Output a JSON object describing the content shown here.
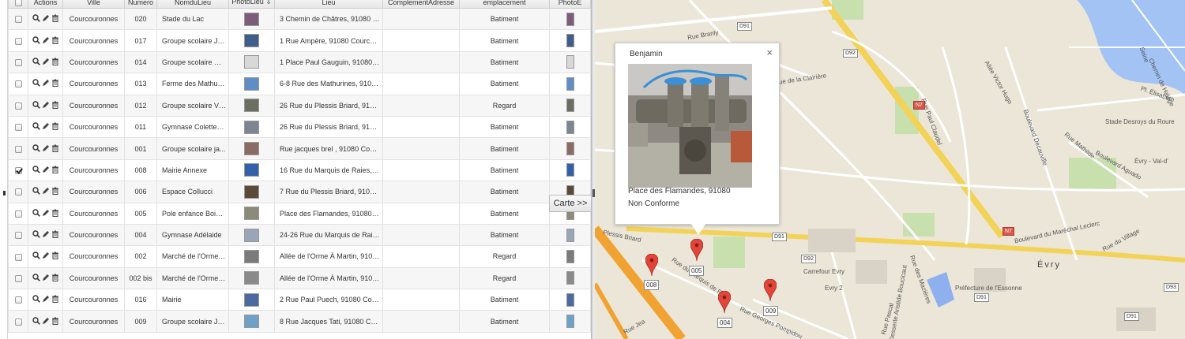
{
  "grid": {
    "columns": [
      "",
      "Actions",
      "Ville",
      "Numero",
      "NomduLieu",
      "PhotoLieu ⇩",
      "Lieu",
      "ComplementAdresse",
      "emplacement",
      "PhotoE"
    ],
    "rows": [
      {
        "checked": false,
        "ville": "Courcouronnes",
        "numero": "020",
        "nom": "Stade du Lac",
        "lieu": "3 Chemin de Châtres, 91080 C...",
        "complement": "",
        "emplacement": "Batiment",
        "thumb": "#7c5c7a"
      },
      {
        "checked": false,
        "ville": "Courcouronnes",
        "numero": "017",
        "nom": "Groupe scolaire Ju...",
        "lieu": "1 Rue Ampère, 91080 Courcou...",
        "complement": "",
        "emplacement": "Batiment",
        "thumb": "#3f5e8a"
      },
      {
        "checked": false,
        "ville": "Courcouronnes",
        "numero": "014",
        "nom": "Groupe scolaire Pa...",
        "lieu": "1 Place Paul Gauguin, 91080 C...",
        "complement": "",
        "emplacement": "Batiment",
        "thumb": "#d8d8d8"
      },
      {
        "checked": false,
        "ville": "Courcouronnes",
        "numero": "013",
        "nom": "Ferme des Mathuri...",
        "lieu": "6-8 Rue des Mathurines, 91080...",
        "complement": "",
        "emplacement": "Batiment",
        "thumb": "#5f8ec7"
      },
      {
        "checked": false,
        "ville": "Courcouronnes",
        "numero": "012",
        "nom": "Groupe scolaire Vi...",
        "lieu": "26 Rue du Plessis Briard, 9108...",
        "complement": "",
        "emplacement": "Regard",
        "thumb": "#6b6f61"
      },
      {
        "checked": false,
        "ville": "Courcouronnes",
        "numero": "011",
        "nom": "Gymnase Colette B...",
        "lieu": "26 Rue du Plessis Briard, 9108...",
        "complement": "",
        "emplacement": "Batiment",
        "thumb": "#7d8591"
      },
      {
        "checked": false,
        "ville": "Courcouronnes",
        "numero": "001",
        "nom": "Groupe scolaire ja...",
        "lieu": "Rue jacques brel , 91080 Cour...",
        "complement": "",
        "emplacement": "Batiment",
        "thumb": "#8a6c64"
      },
      {
        "checked": true,
        "ville": "Courcouronnes",
        "numero": "008",
        "nom": "Mairie Annexe",
        "lieu": "16 Rue du Marquis de Raies, 9...",
        "complement": "",
        "emplacement": "Batiment",
        "thumb": "#3360a8"
      },
      {
        "checked": false,
        "ville": "Courcouronnes",
        "numero": "006",
        "nom": "Espace Collucci",
        "lieu": "7 Rue du Plessis Briard, 91080...",
        "complement": "",
        "emplacement": "Batiment",
        "thumb": "#5a4a3a"
      },
      {
        "checked": false,
        "ville": "Courcouronnes",
        "numero": "005",
        "nom": "Pole enfance Bois ...",
        "lieu": "Place des Flamandes, 91080 C...",
        "complement": "",
        "emplacement": "Batiment",
        "thumb": "#8d8a7a"
      },
      {
        "checked": false,
        "ville": "Courcouronnes",
        "numero": "004",
        "nom": "Gymnase Adélaide",
        "lieu": "24-26 Rue du Marquis de Raie...",
        "complement": "",
        "emplacement": "Batiment",
        "thumb": "#9aa6b8"
      },
      {
        "checked": false,
        "ville": "Courcouronnes",
        "numero": "002",
        "nom": "Marché de l'Orme ...",
        "lieu": "Allée de l'Orme À Martin, 9108...",
        "complement": "",
        "emplacement": "Regard",
        "thumb": "#7b7b7b"
      },
      {
        "checked": false,
        "ville": "Courcouronnes",
        "numero": "002 bis",
        "nom": "Marché de l'Orme ...",
        "lieu": "Allée de l'Orme À Martin, 9108...",
        "complement": "",
        "emplacement": "Regard",
        "thumb": "#8a8a8a"
      },
      {
        "checked": false,
        "ville": "Courcouronnes",
        "numero": "016",
        "nom": "Mairie",
        "lieu": "2 Rue Paul Puech, 91080 Cour...",
        "complement": "",
        "emplacement": "Batiment",
        "thumb": "#4d6aa0"
      },
      {
        "checked": false,
        "ville": "Courcouronnes",
        "numero": "009",
        "nom": "Groupe scolaire Ja...",
        "lieu": "8 Rue Jacques Tati, 91080 Cou...",
        "complement": "",
        "emplacement": "Batiment",
        "thumb": "#6fa0c8"
      }
    ]
  },
  "toggle_button": "Carte >>",
  "popup": {
    "title": "Benjamin",
    "close": "×",
    "address": "Place des Flamandes, 91080",
    "status": "Non Conforme"
  },
  "map": {
    "labels": {
      "rue_branly": "Rue Branly",
      "rue_clairiere": "Rue de la Clairière",
      "seine": "Seine",
      "chemin_halage": "Chemin de Halage",
      "allee_victor_hugo": "Allée Victor Hugo",
      "boulevard_decauville": "Boulevard Decauville",
      "stade_desroys": "Stade Desroys du Roure",
      "rue_mathilde": "Rue Mathilde",
      "boulevard_aguado": "Boulevard Aguado",
      "evry_val": "Évry - Val-d'",
      "rue_plessis_briard": "Plessis Briard",
      "carrefour": "Carrefour Evry",
      "evry2": "Evry 2",
      "desserte": "Desserte Aristide Boucicaut",
      "rue_mazieres": "Rue des Mazières",
      "prefecture": "Préfecture de l'Essonne",
      "evry": "Évry",
      "boulevard_marechal": "Boulevard du Maréchal Leclerc",
      "rue_village": "Rue du Village",
      "rue_georges": "Rue Georges Pompidou",
      "rue_raies": "Rue du Marquis de Raies",
      "rue_paul_claudel": "Rue Paul Claudel",
      "rue_pascal": "Rue Pascal",
      "pl_elisabeth": "Pl. Élisabeth",
      "rue_jea": "Rue Jea"
    },
    "shields": {
      "d91a": "D91",
      "d92a": "D92",
      "n7a": "N7",
      "d91b": "D91",
      "d92b": "D92",
      "n7b": "N7",
      "d91c": "D91",
      "d93": "D93",
      "d91d": "D91"
    },
    "markers": {
      "m005": "005",
      "m008": "008",
      "m004": "004",
      "m009": "009"
    }
  }
}
